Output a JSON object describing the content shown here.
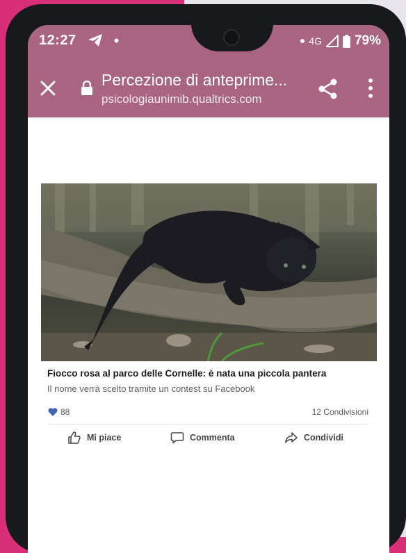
{
  "status_bar": {
    "time": "12:27",
    "network": "4G",
    "battery": "79%"
  },
  "app_bar": {
    "title": "Percezione di anteprime...",
    "url": "psicologiaunimib.qualtrics.com"
  },
  "post": {
    "headline": "Fiocco rosa al parco delle Cornelle: è nata una piccola pantera",
    "subheadline": "Il nome verrà scelto tramite un contest su Facebook",
    "likes_count": "88",
    "shares_text": "12 Condivisioni",
    "actions": {
      "like": "Mi piace",
      "comment": "Commenta",
      "share": "Condividi"
    }
  },
  "colors": {
    "app_bar": "#a86480",
    "background": "#d92e78",
    "like_heart": "#4267b2"
  },
  "icons": [
    "close-icon",
    "lock-icon",
    "share-icon",
    "more-vert-icon",
    "telegram-icon",
    "heart-icon",
    "thumbs-up-icon",
    "comment-icon",
    "forward-icon"
  ]
}
